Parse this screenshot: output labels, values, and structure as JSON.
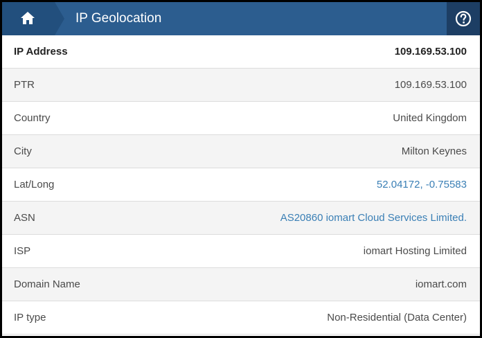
{
  "header": {
    "title": "IP Geolocation",
    "home_icon": "home-icon",
    "help_icon": "help-icon",
    "colors": {
      "bar": "#2c5d8f",
      "home_bg": "#224f7d",
      "help_bg": "#1d3e64",
      "link": "#3a7fb5"
    }
  },
  "rows": [
    {
      "label": "IP Address",
      "value": "109.169.53.100"
    },
    {
      "label": "PTR",
      "value": "109.169.53.100"
    },
    {
      "label": "Country",
      "value": "United Kingdom"
    },
    {
      "label": "City",
      "value": "Milton Keynes"
    },
    {
      "label": "Lat/Long",
      "value": "52.04172, -0.75583"
    },
    {
      "label": "ASN",
      "value": "AS20860 iomart Cloud Services Limited."
    },
    {
      "label": "ISP",
      "value": "iomart Hosting Limited"
    },
    {
      "label": "Domain Name",
      "value": "iomart.com"
    },
    {
      "label": "IP type",
      "value": "Non-Residential (Data Center)"
    }
  ]
}
